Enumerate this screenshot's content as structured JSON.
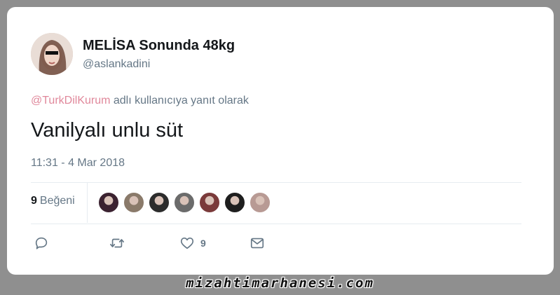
{
  "tweet": {
    "author_name": "MELİSA Sonunda 48kg",
    "author_handle": "@aslankadini",
    "reply_mention": "@TurkDilKurum",
    "reply_suffix": " adlı kullanıcıya yanıt olarak",
    "text": "Vanilyalı unlu süt",
    "timestamp": "11:31 - 4 Mar 2018"
  },
  "stats": {
    "likes_count": "9",
    "likes_label": "Beğeni",
    "liker_avatars": [
      {
        "color": "#3b2230"
      },
      {
        "color": "#8a7a6a"
      },
      {
        "color": "#2c2c2c"
      },
      {
        "color": "#6b6b6b"
      },
      {
        "color": "#7a3a3a"
      },
      {
        "color": "#1e1e1e"
      },
      {
        "color": "#b89a94"
      }
    ]
  },
  "actions": {
    "reply_icon": "reply-icon",
    "retweet_icon": "retweet-icon",
    "like_icon": "heart-icon",
    "like_count": "9",
    "message_icon": "envelope-icon"
  },
  "watermark": {
    "text": "mizahtimarhanesi.com"
  },
  "colors": {
    "mention": "#e0889b",
    "secondary_text": "#657786",
    "primary_text": "#14171a"
  }
}
